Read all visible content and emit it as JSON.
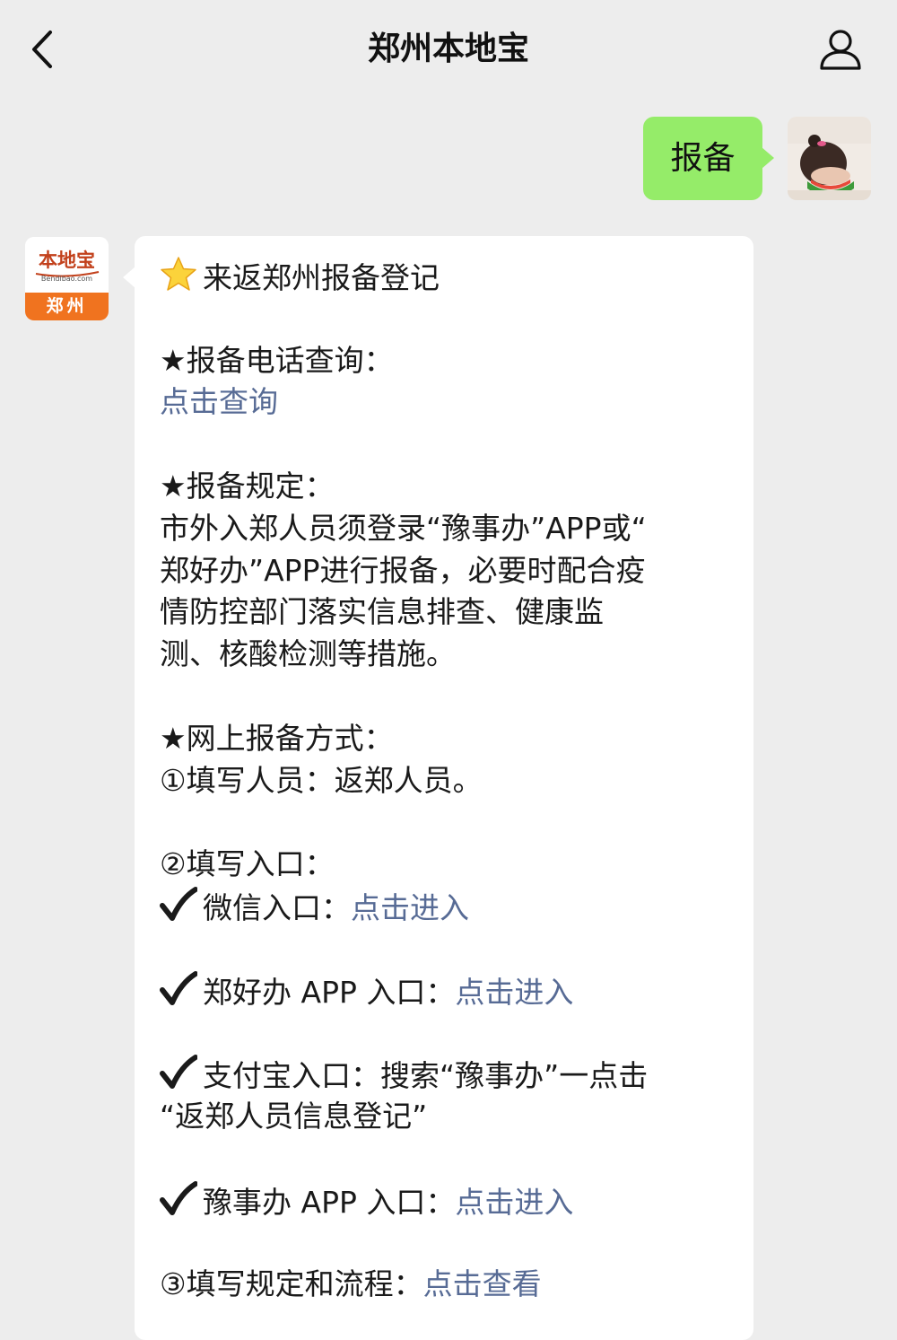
{
  "nav": {
    "title": "郑州本地宝",
    "back_icon": "chevron-left-icon",
    "profile_icon": "user-icon"
  },
  "sent_message": {
    "text": "报备",
    "bubble_color": "#95ec69"
  },
  "bot_avatar": {
    "logo_text": "本地宝",
    "logo_url": "Bendibao.com",
    "logo_city": "郑州",
    "brand_color": "#f0731f"
  },
  "message": {
    "title": "来返郑州报备登记",
    "title_icon": "star-emoji-icon",
    "phone_heading": "★报备电话查询：",
    "phone_link": "点击查询",
    "rules_heading": "★报备规定：",
    "rules_lines": [
      "市外入郑人员须登录“豫事办”APP或“",
      "郑好办”APP进行报备，必要时配合疫",
      "情防控部门落实信息排查、健康监",
      "测、核酸检测等措施。"
    ],
    "online_heading": "★网上报备方式：",
    "step1": "①填写人员：返郑人员。",
    "step2": "②填写入口：",
    "wechat_label": "微信入口：",
    "wechat_link": "点击进入",
    "zhb_label": "郑好办 APP 入口：",
    "zhb_link": "点击进入",
    "alipay_line1": "支付宝入口：搜索“豫事办”一点击",
    "alipay_line2": "“返郑人员信息登记”",
    "ysb_label": "豫事办 APP 入口：",
    "ysb_link": "点击进入",
    "step3_label": "③填写规定和流程：",
    "step3_link": "点击查看",
    "link_color": "#576b95",
    "check_icon": "checkmark-icon"
  }
}
